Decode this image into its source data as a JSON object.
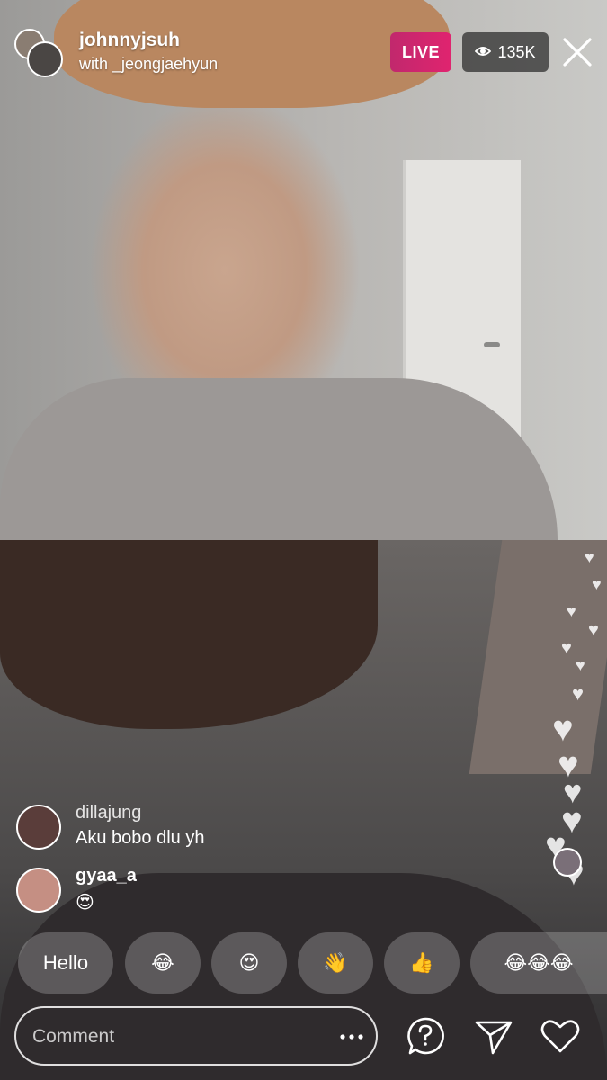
{
  "header": {
    "host_username": "johnnyjsuh",
    "guest_line": "with _jeongjaehyun",
    "live_label": "LIVE",
    "viewer_count": "135K"
  },
  "comments": [
    {
      "username": "dillajung",
      "text": "Aku bobo dlu yh",
      "avatar_color": "#5a3d3a"
    },
    {
      "username": "gyaa_a",
      "text": "😍",
      "avatar_color": "#c58f83"
    }
  ],
  "quick_replies": [
    {
      "label": "Hello",
      "type": "text"
    },
    {
      "label": "😂",
      "type": "emoji"
    },
    {
      "label": "😍",
      "type": "emoji"
    },
    {
      "label": "👋",
      "type": "emoji"
    },
    {
      "label": "👍",
      "type": "emoji"
    },
    {
      "label": "😂😂😂",
      "type": "emoji"
    }
  ],
  "bottom_bar": {
    "comment_placeholder": "Comment",
    "icons": [
      "more-options-icon",
      "question-icon",
      "send-icon",
      "heart-icon"
    ]
  },
  "colors": {
    "live_badge": "#d3266e",
    "overlay_text": "#ffffff"
  }
}
